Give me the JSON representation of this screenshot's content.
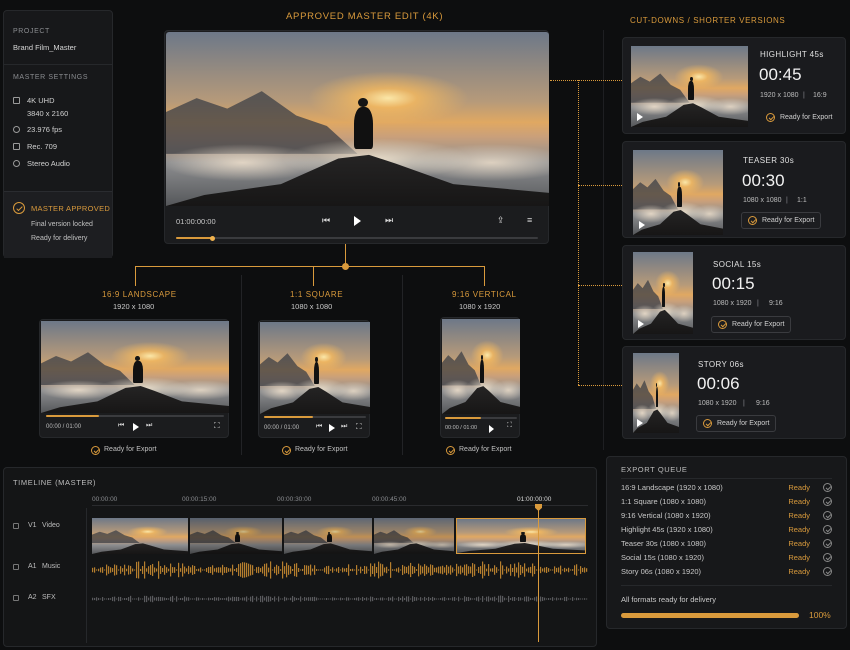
{
  "sidebar": {
    "project_heading": "PROJECT",
    "project_name": "Brand Film_Master",
    "settings_heading": "MASTER SETTINGS",
    "resolution": "4K UHD",
    "resolution_size": "3840 x 2160",
    "fps": "23.976 fps",
    "color": "Rec. 709",
    "audio": "Stereo Audio",
    "approved_title": "MASTER APPROVED",
    "approved_line1": "Final version locked",
    "approved_line2": "Ready for delivery"
  },
  "master": {
    "title": "APPROVED MASTER EDIT (4K)",
    "timecode": "01:00:00:00",
    "progress": 0.1
  },
  "formats": [
    {
      "title": "16:9 LANDSCAPE",
      "size": "1920 x 1080",
      "time": "00:00 / 01:00",
      "status": "Ready for Export",
      "progress": 0.3
    },
    {
      "title": "1:1 SQUARE",
      "size": "1080 x 1080",
      "time": "00:00 / 01:00",
      "status": "Ready for Export",
      "progress": 0.3
    },
    {
      "title": "9:16 VERTICAL",
      "size": "1080 x 1920",
      "time": "00:00 / 01:00",
      "status": "Ready for Export",
      "progress": 0.5
    }
  ],
  "cutdowns": {
    "heading": "CUT-DOWNS / SHORTER VERSIONS",
    "items": [
      {
        "title": "HIGHLIGHT 45s",
        "duration": "00:45",
        "size": "1920 x 1080",
        "ratio": "16:9",
        "status": "Ready for Export"
      },
      {
        "title": "TEASER 30s",
        "duration": "00:30",
        "size": "1080 x 1080",
        "ratio": "1:1",
        "status": "Ready for Export"
      },
      {
        "title": "SOCIAL 15s",
        "duration": "00:15",
        "size": "1080 x 1920",
        "ratio": "9:16",
        "status": "Ready for Export"
      },
      {
        "title": "STORY 06s",
        "duration": "00:06",
        "size": "1080 x 1920",
        "ratio": "9:16",
        "status": "Ready for Export"
      }
    ]
  },
  "timeline": {
    "heading": "TIMELINE  (MASTER)",
    "ruler": [
      "00:00:00",
      "00:00:15:00",
      "00:00:30:00",
      "00:00:45:00",
      "01:00:00:00"
    ],
    "tracks": [
      {
        "id": "V1",
        "name": "Video"
      },
      {
        "id": "A1",
        "name": "Music"
      },
      {
        "id": "A2",
        "name": "SFX"
      }
    ]
  },
  "queue": {
    "heading": "EXPORT QUEUE",
    "rows": [
      {
        "label": "16:9 Landscape (1920 x 1080)",
        "status": "Ready"
      },
      {
        "label": "1:1 Square (1080 x 1080)",
        "status": "Ready"
      },
      {
        "label": "9:16 Vertical (1080 x 1920)",
        "status": "Ready"
      },
      {
        "label": "Highlight 45s (1920 x 1080)",
        "status": "Ready"
      },
      {
        "label": "Teaser 30s (1080 x 1080)",
        "status": "Ready"
      },
      {
        "label": "Social 15s (1080 x 1920)",
        "status": "Ready"
      },
      {
        "label": "Story 06s (1080 x 1920)",
        "status": "Ready"
      }
    ],
    "summary": "All formats ready for delivery",
    "percent": "100%",
    "progress": 1.0
  },
  "colors": {
    "accent": "#d99a3c",
    "background": "#0d0e0f",
    "panel": "#17181a"
  }
}
